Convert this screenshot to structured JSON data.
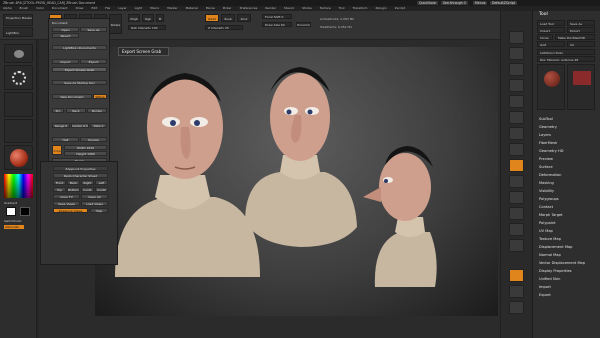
{
  "titlebar": {
    "title": "ZBrush 4R6 [ZTOOL:PM3D_HEAD_CAR] ZBrush Document",
    "quicksave": "QuickSave",
    "see_through": "See-through 0",
    "menus": "Menus",
    "default_zscript": "DefaultZScript"
  },
  "menubar": {
    "items": [
      "Alpha",
      "Brush",
      "Color",
      "Document",
      "Draw",
      "Edit",
      "File",
      "Layer",
      "Light",
      "Macro",
      "Marker",
      "Material",
      "Movie",
      "Picker",
      "Preferences",
      "Render",
      "Stencil",
      "Stroke",
      "Texture",
      "Tool",
      "Transform",
      "Zplugin",
      "Zscript"
    ]
  },
  "topshelf": {
    "projection_master": "Projection Master",
    "lightbox": "LightBox",
    "edit": "Edit",
    "draw": "Draw",
    "move": "Move",
    "scale": "Scale",
    "rotate": "Rotate",
    "mrgb": "Mrgb",
    "rgb": "Rgb",
    "m": "M",
    "zadd": "Zadd",
    "zsub": "Zsub",
    "zcut": "Zcut",
    "focal_shift": "Focal Shift 0",
    "draw_size": "Draw Size 64",
    "z_intensity": "Z Intensity 25",
    "rgb_intensity": "Rgb Intensity 100",
    "dynamic": "Dynamic",
    "active_points": "ActivePoints: 2.093 Mil",
    "total_points": "TotalPoints: 6.052 Mil"
  },
  "left": {
    "gradient_label": "Gradient",
    "switch_color": "SwitchColor",
    "alternate": "Alternate"
  },
  "doc_menu": {
    "header": "Document",
    "open": "Open",
    "save_as": "Save As",
    "revert": "Revert",
    "lightbox_documents": "LightBox>Documents",
    "import": "Import",
    "export": "Export",
    "export_screen_grab": "Export Screen Grab",
    "save_as_startup": "Save As Startup Doc",
    "new_document": "New Document",
    "wsize": "WSize",
    "pro": "Pro",
    "back": "Back",
    "border": "Border",
    "range": "Range 0",
    "center": "Center 0.5",
    "rate": "Rate 0",
    "half": "Half",
    "double": "Double",
    "crop": "Crop",
    "width": "Width 1620",
    "height": "Height 1080",
    "resize": "Resize",
    "zapplink": "ZAppLink Properties",
    "zapplink2": "ZAppLinkProperties",
    "pannings": "Pan&Zoom"
  },
  "doc_sub": {
    "header": "ZAppLink Properties",
    "redo": "Redo Character Sheet",
    "front": "Front",
    "back": "Back",
    "right": "Right",
    "left": "Left",
    "top": "Top",
    "bottom": "Bottom",
    "cust1": "Cust1",
    "cust2": "Cust2",
    "clear_fv": "Clear FV",
    "clear_all": "Clear All",
    "save_views": "Save Views",
    "load_views": "Load Views",
    "zapplink_views": "ZAppLink Views",
    "help": "Help"
  },
  "tooltip": {
    "text": "Export Screen Grab"
  },
  "right_panel": {
    "header": "Tool",
    "load_tool": "Load Tool",
    "save_as": "Save As",
    "import": "Import",
    "export": "Export",
    "clone": "Clone",
    "make_polymesh": "Make PolyMesh3D",
    "goz": "GoZ",
    "all": "All",
    "lightbox_tools": "Lightbox>Tools",
    "current_tool": "Rpz_Fabrezio_antenna 48",
    "items": [
      "SubTool",
      "Geometry",
      "Layers",
      "FiberMesh",
      "Geometry HD",
      "Preview",
      "Surface",
      "Deformation",
      "Masking",
      "Visibility",
      "Polygroups",
      "Contact",
      "Morph Target",
      "Polypaint",
      "UV Map",
      "Texture Map",
      "Displacement Map",
      "Normal Map",
      "Vector Displacement Map",
      "Display Properties",
      "Unified Skin",
      "Import",
      "Export"
    ]
  }
}
